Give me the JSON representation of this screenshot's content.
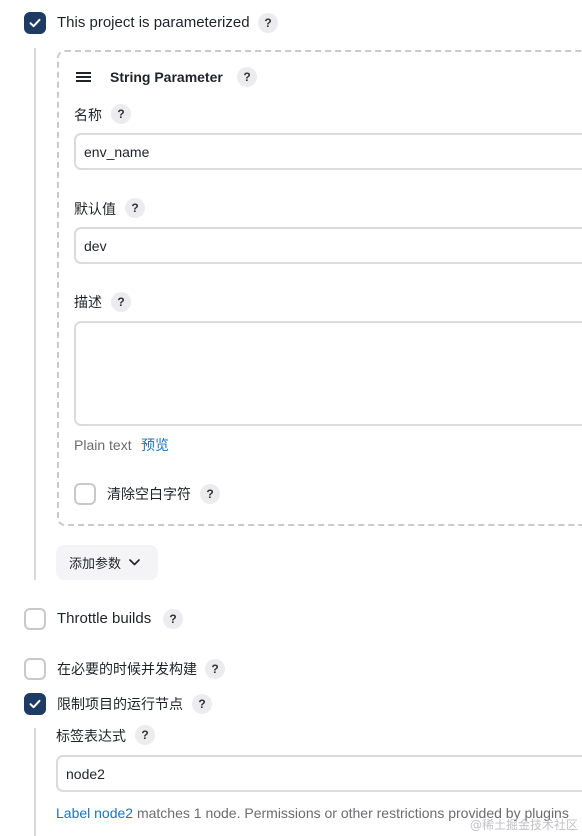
{
  "parameterized": {
    "label": "This project is parameterized",
    "checked": true
  },
  "string_parameter": {
    "title": "String Parameter",
    "name_label": "名称",
    "name_value": "env_name",
    "default_label": "默认值",
    "default_value": "dev",
    "description_label": "描述",
    "description_value": "",
    "format_label": "Plain text",
    "preview_link": "预览",
    "trim_label": "清除空白字符",
    "trim_checked": false
  },
  "add_param_button": "添加参数",
  "throttle": {
    "label": "Throttle builds",
    "checked": false
  },
  "concurrent": {
    "label": "在必要的时候并发构建",
    "checked": false
  },
  "restrict": {
    "label": "限制项目的运行节点",
    "checked": true
  },
  "label_expression": {
    "label": "标签表达式",
    "value": "node2"
  },
  "label_status": {
    "link": "Label node2",
    "text": " matches 1 node. Permissions or other restrictions provided by plugins"
  },
  "help_text": "?",
  "watermark": "@稀土掘金技术社区",
  "colors": {
    "checked_bg": "#1d3b63",
    "link": "#1a73c4",
    "border": "#dadadf"
  }
}
